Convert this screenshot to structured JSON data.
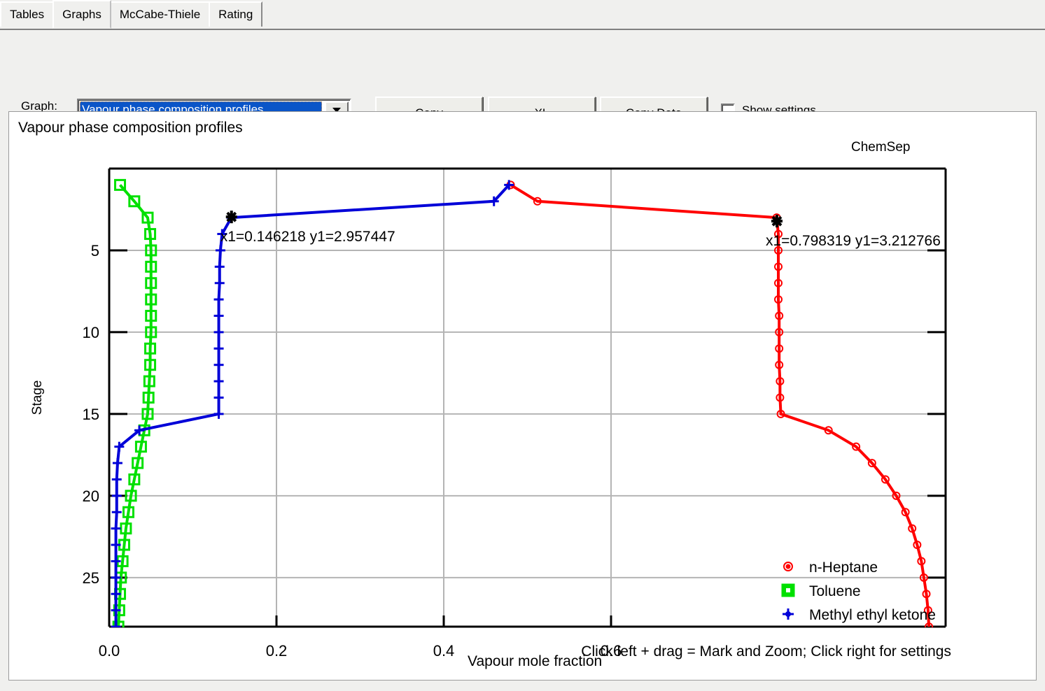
{
  "tabs": [
    {
      "label": "Tables",
      "active": false
    },
    {
      "label": "Graphs",
      "active": true
    },
    {
      "label": "McCabe-Thiele",
      "active": false
    },
    {
      "label": "Rating",
      "active": false
    }
  ],
  "toolbar": {
    "graph_label": "Graph:",
    "selected_graph": "Vapour phase composition profiles",
    "dropdown_icon": "chevron-down-icon",
    "copy_label": "Copy",
    "xl_label": "XL",
    "copy_data_label": "Copy Data",
    "show_settings_label": "Show settings",
    "show_settings_checked": false
  },
  "status": {
    "hint": "Click left + drag = Mark and Zoom; Click right for settings"
  },
  "chart_data": {
    "type": "line",
    "title": "Vapour phase composition profiles",
    "watermark": "ChemSep",
    "xlabel": "Vapour mole fraction",
    "ylabel": "Stage",
    "xlim": [
      0.0,
      1.0
    ],
    "ylim": [
      0.0,
      28.0
    ],
    "xticks": [
      0.0,
      0.2,
      0.4,
      0.6
    ],
    "xticklabels": [
      "0.0",
      "0.2",
      "0.4",
      "0.6"
    ],
    "yticks": [
      5,
      10,
      15,
      20,
      25
    ],
    "yticklabels": [
      "5",
      "10",
      "15",
      "20",
      "25"
    ],
    "grid": true,
    "y_inverted": true,
    "legend_position": "bottom-right",
    "colors": {
      "n-Heptane": "#ff0000",
      "Toluene": "#00e000",
      "Methyl ethyl ketone": "#0000d8",
      "marker": "#000000",
      "grid": "#b4b4b4",
      "axis": "#000000"
    },
    "annotations": [
      {
        "text": "x1=0.146218 y1=2.957447",
        "x": 0.146218,
        "y": 2.957447,
        "marker": "star"
      },
      {
        "text": "x1=0.798319 y1=3.212766",
        "x": 0.798319,
        "y": 3.212766,
        "marker": "star"
      }
    ],
    "series": [
      {
        "name": "n-Heptane",
        "marker": "circle",
        "stages": [
          1,
          2,
          3,
          4,
          5,
          6,
          7,
          8,
          9,
          10,
          11,
          12,
          13,
          14,
          15,
          16,
          17,
          18,
          19,
          20,
          21,
          22,
          23,
          24,
          25,
          26,
          27,
          28
        ],
        "values": [
          0.48,
          0.512,
          0.798,
          0.8,
          0.8,
          0.8,
          0.8,
          0.8,
          0.801,
          0.801,
          0.801,
          0.801,
          0.802,
          0.802,
          0.803,
          0.86,
          0.893,
          0.912,
          0.928,
          0.941,
          0.952,
          0.96,
          0.966,
          0.971,
          0.974,
          0.977,
          0.979,
          0.98
        ]
      },
      {
        "name": "Toluene",
        "marker": "square",
        "stages": [
          1,
          2,
          3,
          4,
          5,
          6,
          7,
          8,
          9,
          10,
          11,
          12,
          13,
          14,
          15,
          16,
          17,
          18,
          19,
          20,
          21,
          22,
          23,
          24,
          25,
          26,
          27,
          28
        ],
        "values": [
          0.013,
          0.03,
          0.046,
          0.049,
          0.05,
          0.05,
          0.05,
          0.05,
          0.05,
          0.05,
          0.049,
          0.049,
          0.048,
          0.047,
          0.046,
          0.042,
          0.038,
          0.034,
          0.03,
          0.026,
          0.023,
          0.02,
          0.018,
          0.016,
          0.014,
          0.013,
          0.012,
          0.011
        ]
      },
      {
        "name": "Methyl ethyl ketone",
        "marker": "plus",
        "stages": [
          1,
          2,
          3,
          4,
          5,
          6,
          7,
          8,
          9,
          10,
          11,
          12,
          13,
          14,
          15,
          16,
          17,
          18,
          19,
          20,
          21,
          22,
          23,
          24,
          25,
          26,
          27,
          28
        ],
        "values": [
          0.478,
          0.46,
          0.146,
          0.135,
          0.133,
          0.132,
          0.132,
          0.131,
          0.131,
          0.131,
          0.131,
          0.131,
          0.131,
          0.131,
          0.131,
          0.036,
          0.012,
          0.01,
          0.009,
          0.009,
          0.009,
          0.008,
          0.008,
          0.008,
          0.008,
          0.008,
          0.008,
          0.008
        ]
      }
    ],
    "legend": [
      {
        "label": "n-Heptane",
        "marker": "circle",
        "color": "#ff0000"
      },
      {
        "label": "Toluene",
        "marker": "square",
        "color": "#00e000"
      },
      {
        "label": "Methyl ethyl ketone",
        "marker": "plus",
        "color": "#0000d8"
      }
    ]
  }
}
